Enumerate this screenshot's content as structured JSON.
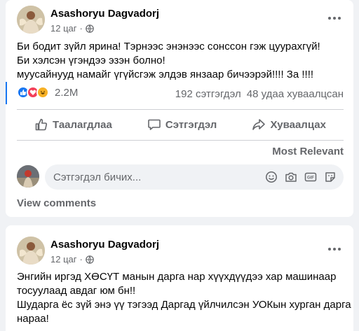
{
  "colors": {
    "background": "#f0f2f5",
    "card": "#ffffff",
    "secondary_text": "#65676b",
    "like_blue": "#1877f2",
    "love_red": "#f33e58",
    "haha_yellow": "#f7b125"
  },
  "posts": [
    {
      "author": "Asashoryu Dagvadorj",
      "time": "12 цаг",
      "privacy_icon": "globe-icon",
      "text_lines": [
        "Би бодит зүйл ярина! Тэрнээс энэнээс сонссон гэж цуурахгүй!",
        "Би хэлсэн үгэндээ эзэн болно!",
        " муусайнууд намайг үгүйсгэж элдэв янзаар бичээрэй!!!! За !!!!"
      ],
      "reactions": {
        "icons": [
          "like-icon",
          "love-icon",
          "haha-icon"
        ],
        "count": "2.2M"
      },
      "comments_count": "192 сэтгэгдэл",
      "shares_count": "48 удаа хуваалцсан",
      "actions": {
        "like": "Таалагдлаа",
        "comment": "Сэтгэгдэл",
        "share": "Хуваалцах"
      },
      "sort_label": "Most Relevant",
      "comment_placeholder": "Сэтгэгдэл бичих...",
      "comment_icons": [
        "emoji-icon",
        "camera-icon",
        "gif-icon",
        "sticker-icon"
      ],
      "view_comments": "View comments"
    },
    {
      "author": "Asashoryu Dagvadorj",
      "time": "12 цаг",
      "privacy_icon": "globe-icon",
      "text_lines": [
        "Энгийн иргэд ХӨСҮТ манын дарга нар хүүхдүүдээ хар машинаар",
        "тосуулаад авдаг юм бн!!",
        "Шударга ёс зүй энэ үү тэгээд Даргад үйлчилсэн УОКын хурган дарга",
        "нараа!"
      ]
    }
  ]
}
